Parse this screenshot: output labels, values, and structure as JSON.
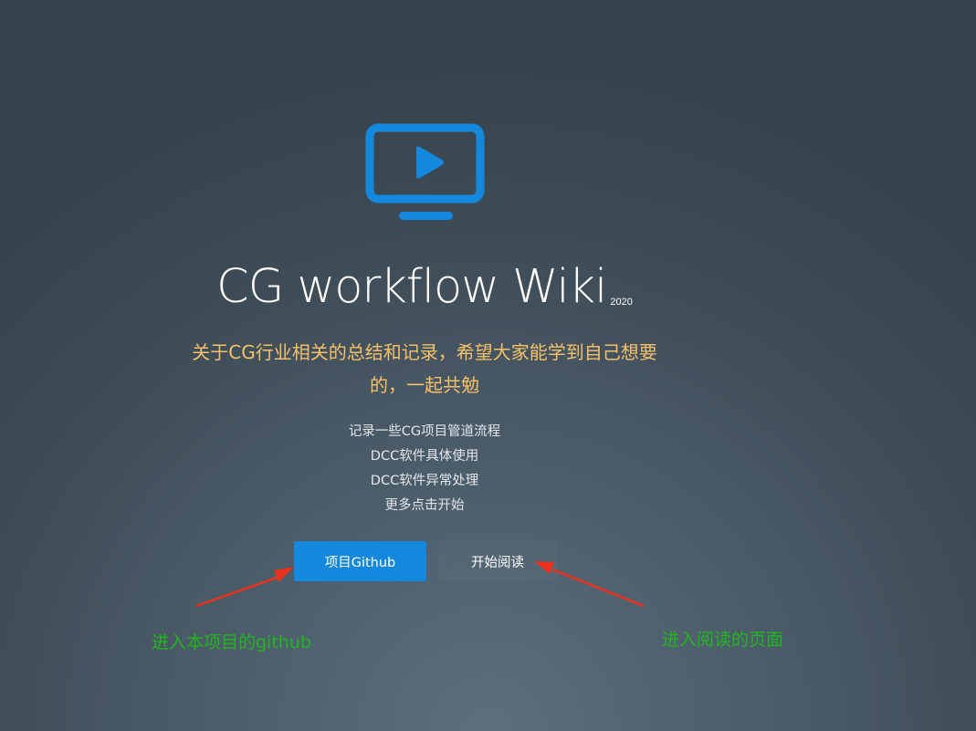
{
  "logo": {
    "icon": "tv-play-icon",
    "color": "#1388dd"
  },
  "title": {
    "text": "CG workflow Wiki",
    "sup": "2020"
  },
  "tagline": [
    "关于CG行业相关的总结和记录，希望大家能学到自己想要",
    "的，一起共勉"
  ],
  "features": [
    "记录一些CG项目管道流程",
    "DCC软件具体使用",
    "DCC软件异常处理",
    "更多点击开始"
  ],
  "buttons": {
    "github": "项目Github",
    "read": "开始阅读"
  },
  "annotations": {
    "github": "进入本项目的github",
    "read": "进入阅读的页面"
  },
  "colors": {
    "accent": "#1388dd",
    "tagline": "#f5c06a",
    "annotation": "#23b51f",
    "arrow": "#e8321e"
  }
}
